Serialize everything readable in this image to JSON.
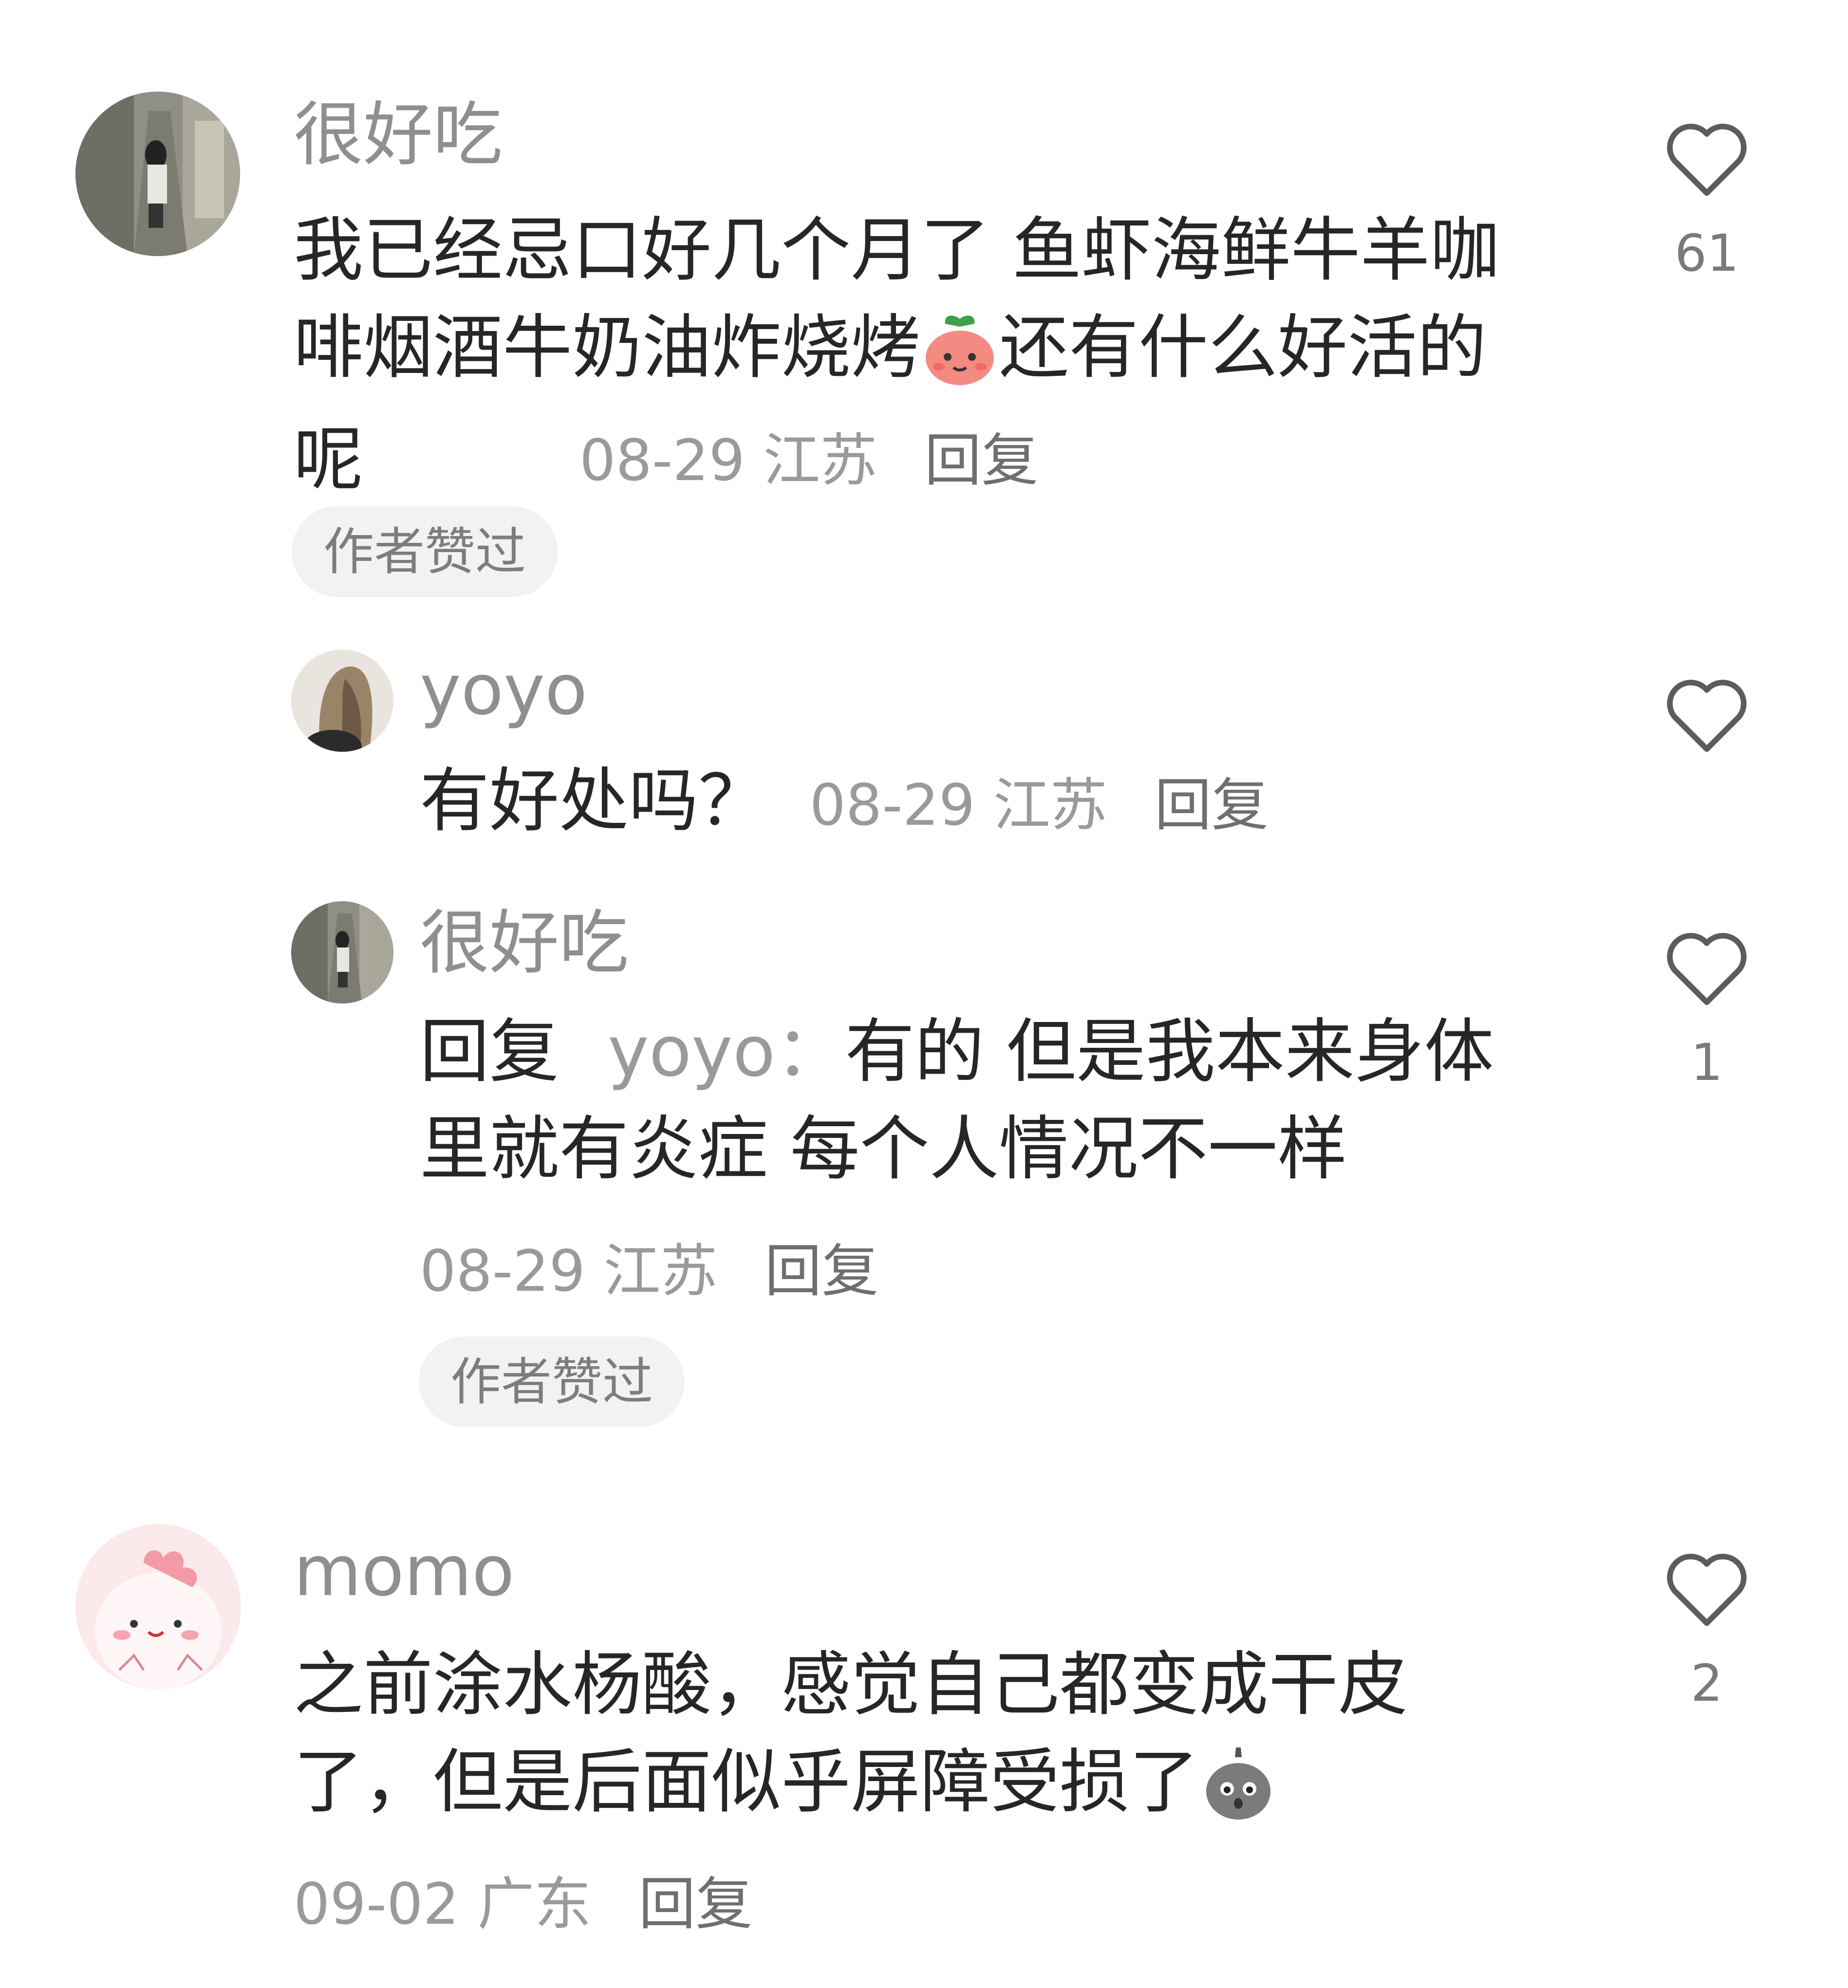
{
  "comments": [
    {
      "username": "很好吃",
      "text_part1": "我已经忌口好几个月了 鱼虾海鲜牛羊咖啡烟酒牛奶油炸烧烤",
      "emoji": "peach-face-emoji",
      "text_part2": "还有什么好活的呢",
      "date": "08-29",
      "location": "江苏",
      "reply_label": "回复",
      "badge": "作者赞过",
      "likes": "61",
      "replies": [
        {
          "username": "yoyo",
          "text": "有好处吗？",
          "date": "08-29",
          "location": "江苏",
          "reply_label": "回复",
          "likes": ""
        },
        {
          "username": "很好吃",
          "reply_prefix": "回复",
          "reply_target": "yoyo：",
          "text": "有的 但是我本来身体里就有炎症 每个人情况不一样",
          "date": "08-29",
          "location": "江苏",
          "reply_label": "回复",
          "badge": "作者赞过",
          "likes": "1"
        }
      ]
    },
    {
      "username": "momo",
      "text_part1": "之前涂水杨酸，感觉自己都变成干皮了，但是后面似乎屏障受损了",
      "emoji": "grey-ghost-emoji",
      "date": "09-02",
      "location": "广东",
      "reply_label": "回复",
      "likes": "2"
    }
  ],
  "icons": {
    "like": "heart-outline-icon"
  },
  "colors": {
    "text": "#262626",
    "username": "#8f8f8f",
    "meta": "#9a9a9a",
    "badge_bg": "#f2f2f2"
  }
}
